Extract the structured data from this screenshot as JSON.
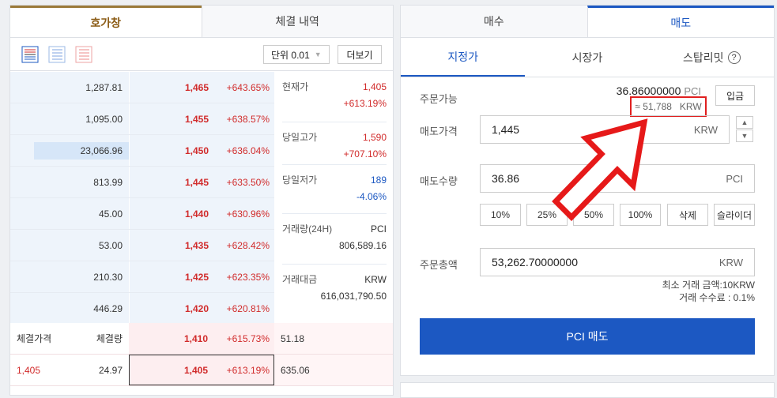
{
  "left_tabs": [
    "호가창",
    "체결 내역"
  ],
  "toolbar": {
    "unit_label": "단위 0.01",
    "more_label": "더보기"
  },
  "asks": [
    {
      "qty": "1,287.81",
      "price": "1,465",
      "rate": "+643.65%",
      "depth": 0
    },
    {
      "qty": "1,095.00",
      "price": "1,455",
      "rate": "+638.57%",
      "depth": 0
    },
    {
      "qty": "23,066.96",
      "price": "1,450",
      "rate": "+636.04%",
      "depth": 0.8
    },
    {
      "qty": "813.99",
      "price": "1,445",
      "rate": "+633.50%",
      "depth": 0
    },
    {
      "qty": "45.00",
      "price": "1,440",
      "rate": "+630.96%",
      "depth": 0
    },
    {
      "qty": "53.00",
      "price": "1,435",
      "rate": "+628.42%",
      "depth": 0
    },
    {
      "qty": "210.30",
      "price": "1,425",
      "rate": "+623.35%",
      "depth": 0
    },
    {
      "qty": "446.29",
      "price": "1,420",
      "rate": "+620.81%",
      "depth": 0
    }
  ],
  "info": [
    {
      "k": "현재가",
      "v": "1,405",
      "sub": "+613.19%",
      "vc": "red",
      "sc": "red"
    },
    {
      "k": "당일고가",
      "v": "1,590",
      "sub": "+707.10%",
      "vc": "red",
      "sc": "red"
    },
    {
      "k": "당일저가",
      "v": "189",
      "sub": "-4.06%",
      "vc": "blue",
      "sc": "blue"
    },
    {
      "k": "거래량(24H)",
      "v": "PCI",
      "sub": "806,589.16",
      "vc": "",
      "sc": ""
    },
    {
      "k": "거래대금",
      "v": "KRW",
      "sub": "616,031,790.50",
      "vc": "",
      "sc": ""
    }
  ],
  "trades_header": {
    "price": "체결가격",
    "qty": "체결량"
  },
  "bids": [
    {
      "tprice": "",
      "tqty": "",
      "price": "1,410",
      "rate": "+615.73%",
      "qty": "51.18",
      "header": true
    },
    {
      "tprice": "1,405",
      "tqty": "24.97",
      "price": "1,405",
      "rate": "+613.19%",
      "qty": "635.06",
      "selected": true
    }
  ],
  "right_tabs": [
    "매수",
    "매도"
  ],
  "order_types": [
    "지정가",
    "시장가",
    "스탑리밋"
  ],
  "form": {
    "avail_label": "주문가능",
    "avail_value": "36.86000000",
    "avail_unit": "PCI",
    "avail_krw": "≈ 51,788",
    "avail_krw_unit": "KRW",
    "deposit": "입금",
    "price_label": "매도가격",
    "price_value": "1,445",
    "price_unit": "KRW",
    "qty_label": "매도수량",
    "qty_value": "36.86",
    "qty_unit": "PCI",
    "pct": [
      "10%",
      "25%",
      "50%",
      "100%",
      "삭제",
      "슬라이더"
    ],
    "total_label": "주문총액",
    "total_value": "53,262.70000000",
    "total_unit": "KRW",
    "min_note": "최소 거래 금액:10KRW",
    "fee_note": "거래 수수료 : 0.1%",
    "submit": "PCI 매도"
  },
  "colors": {
    "accent": "#1c58c2",
    "up": "#d12b2b",
    "gold": "#9b7a3a",
    "highlight": "#e02020"
  }
}
